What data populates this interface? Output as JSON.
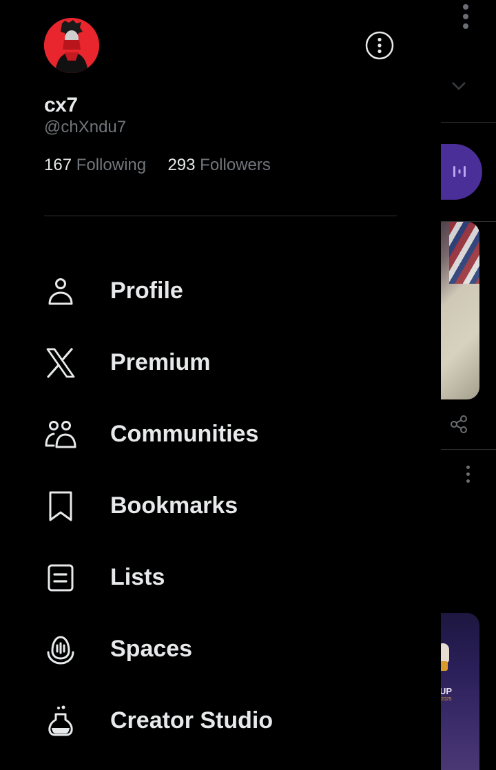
{
  "profile": {
    "display_name": "cx7",
    "handle": "@chXndu7",
    "following_count": "167",
    "following_label": "Following",
    "followers_count": "293",
    "followers_label": "Followers",
    "avatar_color": "#e9262e"
  },
  "menu": [
    {
      "label": "Profile",
      "icon": "person-icon"
    },
    {
      "label": "Premium",
      "icon": "x-logo-icon"
    },
    {
      "label": "Communities",
      "icon": "communities-icon"
    },
    {
      "label": "Bookmarks",
      "icon": "bookmark-icon"
    },
    {
      "label": "Lists",
      "icon": "list-icon"
    },
    {
      "label": "Spaces",
      "icon": "spaces-icon"
    },
    {
      "label": "Creator Studio",
      "icon": "flask-icon"
    }
  ],
  "background": {
    "card_text": "UP",
    "card_subtext": "2025",
    "spaces_pill_color": "#4b2f98"
  },
  "colors": {
    "background": "#000000",
    "primary_text": "#e7e9ea",
    "secondary_text": "#71767b",
    "divider": "#2f3336"
  }
}
